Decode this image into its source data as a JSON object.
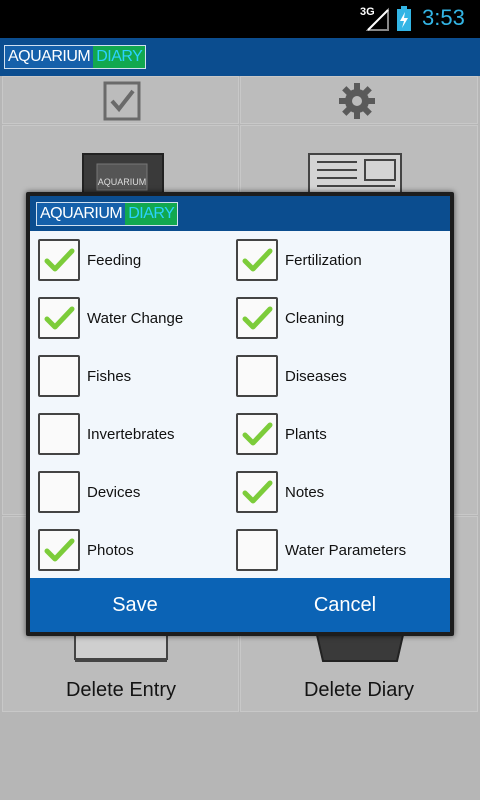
{
  "status_bar": {
    "network": "3G",
    "time": "3:53"
  },
  "app": {
    "logo_part1": "AQUARIUM",
    "logo_part2": "DIARY"
  },
  "background": {
    "labels": {
      "delete_entry": "Delete Entry",
      "delete_diary": "Delete Diary"
    },
    "book_cover_text": "AQUARIUM",
    "icons": [
      "checkbox-icon",
      "gear-icon",
      "diary-book-icon",
      "newspaper-icon",
      "delete-entry-icon",
      "delete-diary-icon"
    ]
  },
  "dialog": {
    "logo_part1": "AQUARIUM",
    "logo_part2": "DIARY",
    "options": [
      {
        "label": "Feeding",
        "checked": true
      },
      {
        "label": "Fertilization",
        "checked": true
      },
      {
        "label": "Water Change",
        "checked": true
      },
      {
        "label": "Cleaning",
        "checked": true
      },
      {
        "label": "Fishes",
        "checked": false
      },
      {
        "label": "Diseases",
        "checked": false
      },
      {
        "label": "Invertebrates",
        "checked": false
      },
      {
        "label": "Plants",
        "checked": true
      },
      {
        "label": "Devices",
        "checked": false
      },
      {
        "label": "Notes",
        "checked": true
      },
      {
        "label": "Photos",
        "checked": true
      },
      {
        "label": "Water Parameters",
        "checked": false
      }
    ],
    "save_label": "Save",
    "cancel_label": "Cancel"
  },
  "colors": {
    "accent": "#0b63b5",
    "title_bar": "#0b4d8f",
    "check": "#7ccc3a",
    "clock": "#33b5e5"
  }
}
